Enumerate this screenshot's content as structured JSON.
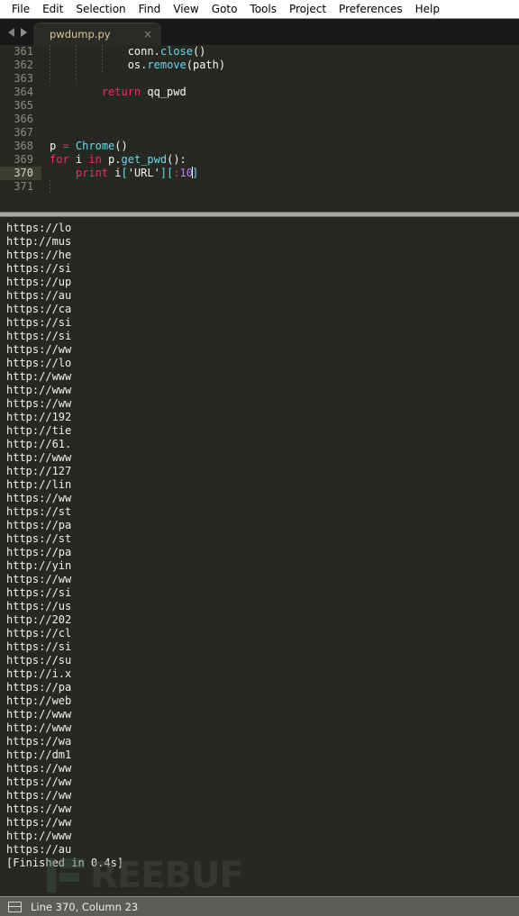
{
  "menubar": {
    "items": [
      {
        "label": "File"
      },
      {
        "label": "Edit"
      },
      {
        "label": "Selection"
      },
      {
        "label": "Find"
      },
      {
        "label": "View"
      },
      {
        "label": "Goto"
      },
      {
        "label": "Tools"
      },
      {
        "label": "Project"
      },
      {
        "label": "Preferences"
      },
      {
        "label": "Help"
      }
    ]
  },
  "tabbar": {
    "nav_back_icon": "arrow-left-icon",
    "nav_forward_icon": "arrow-right-icon",
    "tab": {
      "title": "pwdump.py",
      "close_glyph": "×"
    }
  },
  "editor": {
    "first_line_number": 361,
    "active_line": 370,
    "lines": [
      {
        "num": "361",
        "tokens": [
          {
            "t": "            conn",
            "c": "t-pl"
          },
          {
            "t": ".",
            "c": "t-pl"
          },
          {
            "t": "close",
            "c": "t-fn"
          },
          {
            "t": "()",
            "c": "t-pl"
          }
        ]
      },
      {
        "num": "362",
        "tokens": [
          {
            "t": "            os",
            "c": "t-pl"
          },
          {
            "t": ".",
            "c": "t-pl"
          },
          {
            "t": "remove",
            "c": "t-fn"
          },
          {
            "t": "(path)",
            "c": "t-pl"
          }
        ]
      },
      {
        "num": "363",
        "tokens": []
      },
      {
        "num": "364",
        "tokens": [
          {
            "t": "        ",
            "c": "t-pl"
          },
          {
            "t": "return",
            "c": "t-kw"
          },
          {
            "t": " qq_pwd",
            "c": "t-pl"
          }
        ]
      },
      {
        "num": "365",
        "tokens": []
      },
      {
        "num": "366",
        "tokens": []
      },
      {
        "num": "367",
        "tokens": []
      },
      {
        "num": "368",
        "tokens": [
          {
            "t": "p ",
            "c": "t-pl"
          },
          {
            "t": "=",
            "c": "t-kw"
          },
          {
            "t": " ",
            "c": "t-pl"
          },
          {
            "t": "Chrome",
            "c": "t-fn"
          },
          {
            "t": "()",
            "c": "t-pl"
          }
        ]
      },
      {
        "num": "369",
        "tokens": [
          {
            "t": "for",
            "c": "t-kw"
          },
          {
            "t": " i ",
            "c": "t-pl"
          },
          {
            "t": "in",
            "c": "t-kw"
          },
          {
            "t": " p",
            "c": "t-pl"
          },
          {
            "t": ".",
            "c": "t-pl"
          },
          {
            "t": "get_pwd",
            "c": "t-fn"
          },
          {
            "t": "():",
            "c": "t-pl"
          }
        ]
      },
      {
        "num": "370",
        "tokens": [
          {
            "t": "    ",
            "c": "t-pl"
          },
          {
            "t": "print",
            "c": "t-kw"
          },
          {
            "t": " i",
            "c": "t-pl"
          },
          {
            "t": "[",
            "c": "t-punc"
          },
          {
            "t": "'URL'",
            "c": "t-strw"
          },
          {
            "t": "]",
            "c": "t-punc"
          },
          {
            "t": "[",
            "c": "t-punc"
          },
          {
            "t": ":",
            "c": "t-kw"
          },
          {
            "t": "10",
            "c": "t-num"
          },
          {
            "t": "]",
            "c": "t-punc"
          }
        ],
        "caret_after": true
      },
      {
        "num": "371",
        "tokens": []
      }
    ]
  },
  "console": {
    "lines": [
      "https://lo",
      "http://mus",
      "https://he",
      "https://si",
      "https://up",
      "https://au",
      "https://ca",
      "https://si",
      "https://si",
      "https://ww",
      "https://lo",
      "http://www",
      "http://www",
      "https://ww",
      "http://192",
      "http://tie",
      "http://61.",
      "http://www",
      "http://127",
      "http://lin",
      "https://ww",
      "https://st",
      "https://pa",
      "https://st",
      "https://pa",
      "http://yin",
      "https://ww",
      "https://si",
      "https://us",
      "http://202",
      "https://cl",
      "https://si",
      "https://su",
      "http://i.x",
      "https://pa",
      "http://web",
      "http://www",
      "http://www",
      "https://wa",
      "http://dm1",
      "https://ww",
      "https://ww",
      "https://ww",
      "https://ww",
      "https://ww",
      "http://www",
      "https://au",
      "[Finished in 0.4s]"
    ],
    "watermark": "REEBUF"
  },
  "statusbar": {
    "panel_icon": "panel-toggle-icon",
    "text": "Line 370, Column 23"
  }
}
